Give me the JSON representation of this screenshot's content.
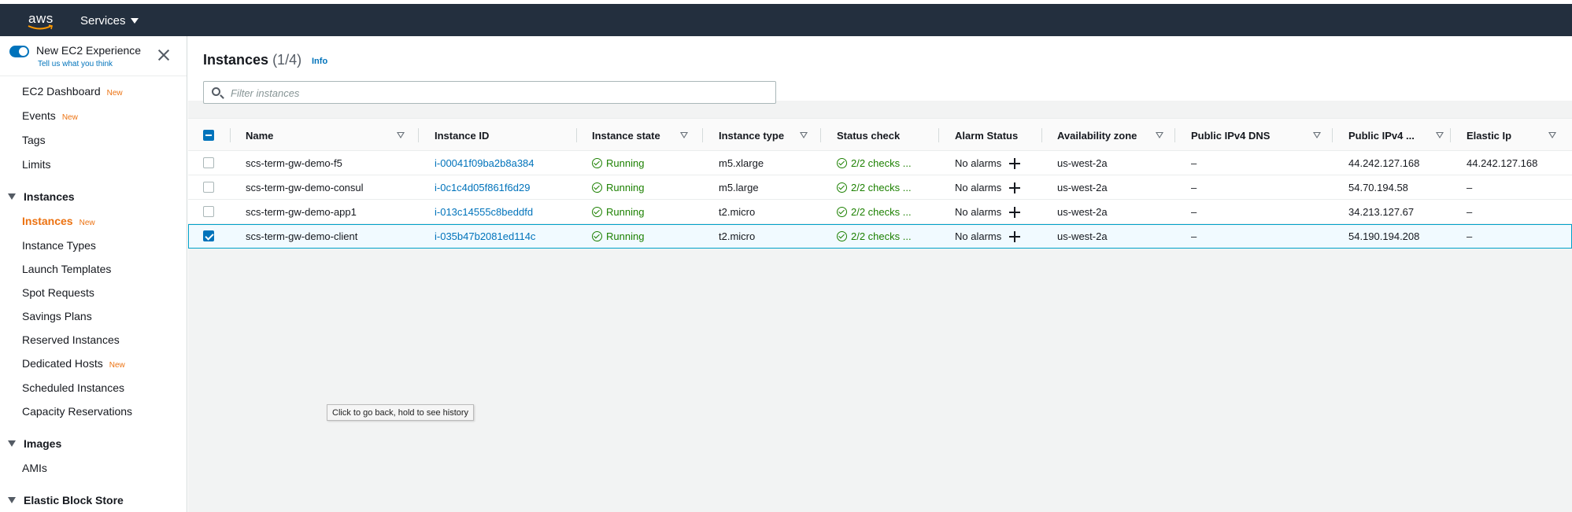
{
  "header": {
    "logo": "aws",
    "services_label": "Services"
  },
  "sidebar": {
    "experience_title": "New EC2 Experience",
    "experience_link": "Tell us what you think",
    "items": [
      {
        "label": "EC2 Dashboard",
        "badge": "New"
      },
      {
        "label": "Events",
        "badge": "New"
      },
      {
        "label": "Tags"
      },
      {
        "label": "Limits"
      }
    ],
    "section_instances": "Instances",
    "instances_items": [
      {
        "label": "Instances",
        "badge": "New"
      },
      {
        "label": "Instance Types"
      },
      {
        "label": "Launch Templates"
      },
      {
        "label": "Spot Requests"
      },
      {
        "label": "Savings Plans"
      },
      {
        "label": "Reserved Instances"
      },
      {
        "label": "Dedicated Hosts",
        "badge": "New"
      },
      {
        "label": "Scheduled Instances"
      },
      {
        "label": "Capacity Reservations"
      }
    ],
    "section_images": "Images",
    "images_items": [
      {
        "label": "AMIs"
      }
    ],
    "section_ebs": "Elastic Block Store"
  },
  "main": {
    "title": "Instances",
    "count": "(1/4)",
    "info": "Info",
    "filter_placeholder": "Filter instances",
    "columns": [
      "Name",
      "Instance ID",
      "Instance state",
      "Instance type",
      "Status check",
      "Alarm Status",
      "Availability zone",
      "Public IPv4 DNS",
      "Public IPv4 ...",
      "Elastic Ip"
    ],
    "rows": [
      {
        "name": "scs-term-gw-demo-f5",
        "id": "i-00041f09ba2b8a384",
        "state": "Running",
        "type": "m5.xlarge",
        "status": "2/2 checks ...",
        "alarm": "No alarms",
        "az": "us-west-2a",
        "dns": "–",
        "ipv4": "44.242.127.168",
        "eip": "44.242.127.168",
        "selected": false
      },
      {
        "name": "scs-term-gw-demo-consul",
        "id": "i-0c1c4d05f861f6d29",
        "state": "Running",
        "type": "m5.large",
        "status": "2/2 checks ...",
        "alarm": "No alarms",
        "az": "us-west-2a",
        "dns": "–",
        "ipv4": "54.70.194.58",
        "eip": "–",
        "selected": false
      },
      {
        "name": "scs-term-gw-demo-app1",
        "id": "i-013c14555c8beddfd",
        "state": "Running",
        "type": "t2.micro",
        "status": "2/2 checks ...",
        "alarm": "No alarms",
        "az": "us-west-2a",
        "dns": "–",
        "ipv4": "34.213.127.67",
        "eip": "–",
        "selected": false
      },
      {
        "name": "scs-term-gw-demo-client",
        "id": "i-035b47b2081ed114c",
        "state": "Running",
        "type": "t2.micro",
        "status": "2/2 checks ...",
        "alarm": "No alarms",
        "az": "us-west-2a",
        "dns": "–",
        "ipv4": "54.190.194.208",
        "eip": "–",
        "selected": true
      }
    ]
  },
  "tooltip": "Click to go back, hold to see history",
  "colors": {
    "navbar": "#232f3e",
    "link": "#0073bb",
    "accent": "#ec7211",
    "success": "#1d8102"
  }
}
